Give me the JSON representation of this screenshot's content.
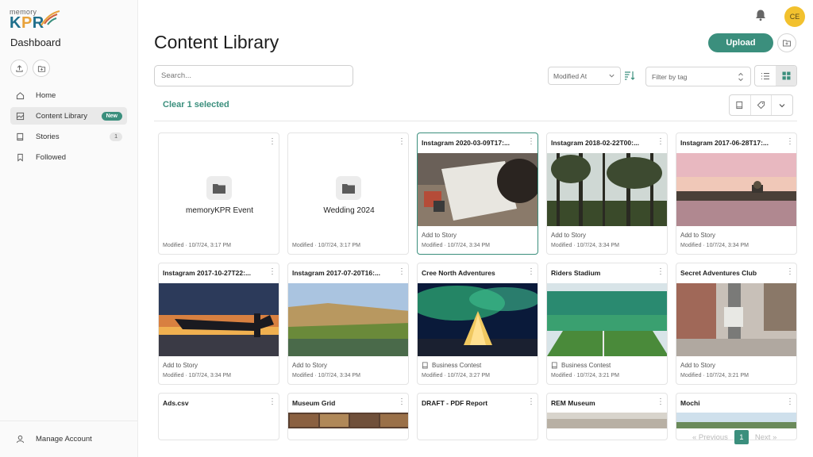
{
  "brand": {
    "small": "memory",
    "big_a": "K",
    "big_b": "P",
    "big_c": "R"
  },
  "sidebar": {
    "title": "Dashboard",
    "items": [
      {
        "label": "Home",
        "icon": "home-icon"
      },
      {
        "label": "Content Library",
        "icon": "library-icon",
        "badge": "New"
      },
      {
        "label": "Stories",
        "icon": "book-icon",
        "badge": "1"
      },
      {
        "label": "Followed",
        "icon": "bookmark-icon"
      }
    ],
    "manage_account": "Manage Account"
  },
  "header": {
    "avatar_initials": "CE",
    "page_title": "Content Library",
    "upload_label": "Upload"
  },
  "toolbar": {
    "search_placeholder": "Search...",
    "sort_value": "Modified At",
    "tag_filter_placeholder": "Filter by tag",
    "clear_selection": "Clear 1 selected"
  },
  "cards": [
    {
      "type": "folder",
      "name": "memoryKPR Event",
      "modified": "Modified · 10/7/24, 3:17 PM"
    },
    {
      "type": "folder",
      "name": "Wedding 2024",
      "modified": "Modified · 10/7/24, 3:17 PM"
    },
    {
      "type": "image",
      "title": "Instagram 2020-03-09T17:...",
      "action": "Add to Story",
      "modified": "Modified · 10/7/24, 3:34 PM",
      "selected": true
    },
    {
      "type": "image",
      "title": "Instagram 2018-02-22T00:...",
      "action": "Add to Story",
      "modified": "Modified · 10/7/24, 3:34 PM"
    },
    {
      "type": "image",
      "title": "Instagram 2017-06-28T17:...",
      "action": "Add to Story",
      "modified": "Modified · 10/7/24, 3:34 PM"
    },
    {
      "type": "image",
      "title": "Instagram 2017-10-27T22:...",
      "action": "Add to Story",
      "modified": "Modified · 10/7/24, 3:34 PM"
    },
    {
      "type": "image",
      "title": "Instagram 2017-07-20T16:...",
      "action": "Add to Story",
      "modified": "Modified · 10/7/24, 3:34 PM"
    },
    {
      "type": "image",
      "title": "Cree North Adventures",
      "action": "Business Contest",
      "modified": "Modified · 10/7/24, 3:27 PM"
    },
    {
      "type": "image",
      "title": "Riders Stadium",
      "action": "Business Contest",
      "modified": "Modified · 10/7/24, 3:21 PM"
    },
    {
      "type": "image",
      "title": "Secret Adventures Club",
      "action": "Add to Story",
      "modified": "Modified · 10/7/24, 3:21 PM"
    },
    {
      "type": "file",
      "title": "Ads.csv"
    },
    {
      "type": "image",
      "title": "Museum Grid"
    },
    {
      "type": "file",
      "title": "DRAFT - PDF Report"
    },
    {
      "type": "image",
      "title": "REM Museum"
    },
    {
      "type": "image",
      "title": "Mochi"
    }
  ],
  "pagination": {
    "previous": "« Previous",
    "current": "1",
    "next": "Next »"
  },
  "colors": {
    "accent": "#3b8f7d",
    "avatar": "#f2c12e"
  }
}
